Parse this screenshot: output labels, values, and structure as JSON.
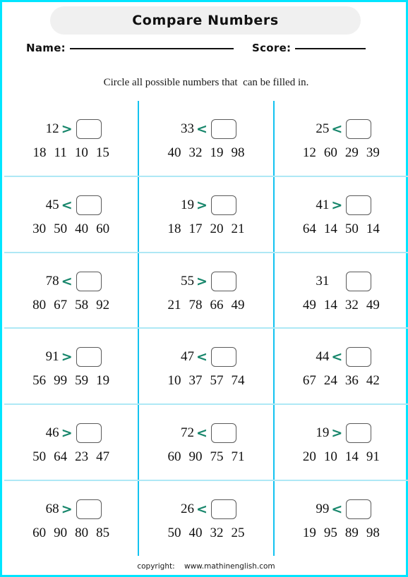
{
  "page": {
    "title": "Compare Numbers",
    "instruction": "Circle all possible numbers that  can be filled in.",
    "footer": "copyright:    www.mathinenglish.com",
    "border_color": "#00e5ff",
    "title_pill_color": "#f0f0f0",
    "operator_color": "#17866b",
    "column_divider_color": "#12c2f0",
    "row_divider_color": "#aee8f5"
  },
  "fields": {
    "name_label": "Name:",
    "name_value": "",
    "score_label": "Score:",
    "score_value": ""
  },
  "problems": [
    [
      {
        "operand": "12",
        "operator": ">",
        "answer": "",
        "choices": [
          "18",
          "11",
          "10",
          "15"
        ]
      },
      {
        "operand": "33",
        "operator": "<",
        "answer": "",
        "choices": [
          "40",
          "32",
          "19",
          "98"
        ]
      },
      {
        "operand": "25",
        "operator": "<",
        "answer": "",
        "choices": [
          "12",
          "60",
          "29",
          "39"
        ]
      }
    ],
    [
      {
        "operand": "45",
        "operator": "<",
        "answer": "",
        "choices": [
          "30",
          "50",
          "40",
          "60"
        ]
      },
      {
        "operand": "19",
        "operator": ">",
        "answer": "",
        "choices": [
          "18",
          "17",
          "20",
          "21"
        ]
      },
      {
        "operand": "41",
        "operator": ">",
        "answer": "",
        "choices": [
          "64",
          "14",
          "50",
          "14"
        ]
      }
    ],
    [
      {
        "operand": "78",
        "operator": "<",
        "answer": "",
        "choices": [
          "80",
          "67",
          "58",
          "92"
        ]
      },
      {
        "operand": "55",
        "operator": ">",
        "answer": "",
        "choices": [
          "21",
          "78",
          "66",
          "49"
        ]
      },
      {
        "operand": "31",
        "operator": "",
        "answer": "",
        "choices": [
          "49",
          "14",
          "32",
          "49"
        ]
      }
    ],
    [
      {
        "operand": "91",
        "operator": ">",
        "answer": "",
        "choices": [
          "56",
          "99",
          "59",
          "19"
        ]
      },
      {
        "operand": "47",
        "operator": "<",
        "answer": "",
        "choices": [
          "10",
          "37",
          "57",
          "74"
        ]
      },
      {
        "operand": "44",
        "operator": "<",
        "answer": "",
        "choices": [
          "67",
          "24",
          "36",
          "42"
        ]
      }
    ],
    [
      {
        "operand": "46",
        "operator": ">",
        "answer": "",
        "choices": [
          "50",
          "64",
          "23",
          "47"
        ]
      },
      {
        "operand": "72",
        "operator": "<",
        "answer": "",
        "choices": [
          "60",
          "90",
          "75",
          "71"
        ]
      },
      {
        "operand": "19",
        "operator": ">",
        "answer": "",
        "choices": [
          "20",
          "10",
          "14",
          "91"
        ]
      }
    ],
    [
      {
        "operand": "68",
        "operator": ">",
        "answer": "",
        "choices": [
          "60",
          "90",
          "80",
          "85"
        ]
      },
      {
        "operand": "26",
        "operator": "<",
        "answer": "",
        "choices": [
          "50",
          "40",
          "32",
          "25"
        ]
      },
      {
        "operand": "99",
        "operator": "<",
        "answer": "",
        "choices": [
          "19",
          "95",
          "89",
          "98"
        ]
      }
    ]
  ]
}
